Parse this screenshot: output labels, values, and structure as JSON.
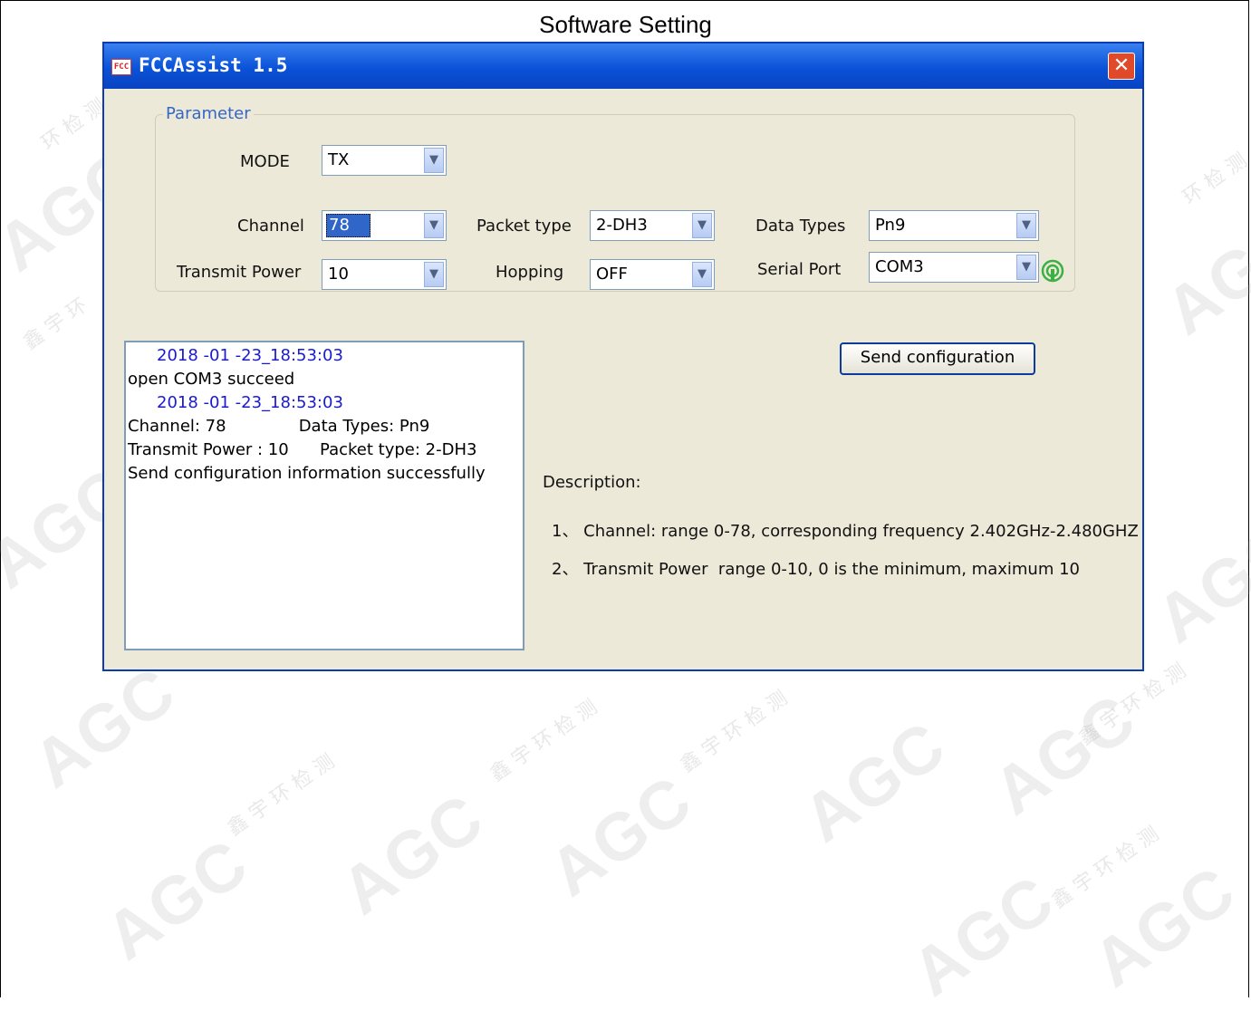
{
  "document": {
    "title": "Software Setting"
  },
  "watermark": {
    "logo": "AGC",
    "text": "鑫宇环检测"
  },
  "window": {
    "title": "FCCAssist 1.5",
    "icon_text": "FCC",
    "close_glyph": "✕"
  },
  "parameter": {
    "group_label": "Parameter",
    "mode": {
      "label": "MODE",
      "value": "TX"
    },
    "channel": {
      "label": "Channel",
      "value": "78"
    },
    "packet_type": {
      "label": "Packet type",
      "value": "2-DH3"
    },
    "data_types": {
      "label": "Data Types",
      "value": "Pn9"
    },
    "transmit_power": {
      "label": "Transmit Power",
      "value": "10"
    },
    "hopping": {
      "label": "Hopping",
      "value": "OFF"
    },
    "serial_port": {
      "label": "Serial Port",
      "value": "COM3"
    }
  },
  "log": {
    "lines": [
      "2018 -01 -23_18:53:03",
      "open COM3 succeed",
      "2018 -01 -23_18:53:03",
      "Channel: 78              Data Types: Pn9",
      "Transmit Power : 10      Packet type: 2-DH3",
      "Send configuration information successfully"
    ]
  },
  "send_button": {
    "label": "Send configuration"
  },
  "description": {
    "heading": "Description:",
    "items": [
      "1、 Channel: range 0-78, corresponding frequency 2.402GHz-2.480GHZ",
      "2、 Transmit Power  range 0-10, 0 is the minimum, maximum 10"
    ]
  },
  "colors": {
    "titlebar": "#0a52d8",
    "dialog_bg": "#ece9d8",
    "timestamp": "#1a1ad2",
    "close": "#e1492b",
    "group_label": "#3466c8"
  }
}
